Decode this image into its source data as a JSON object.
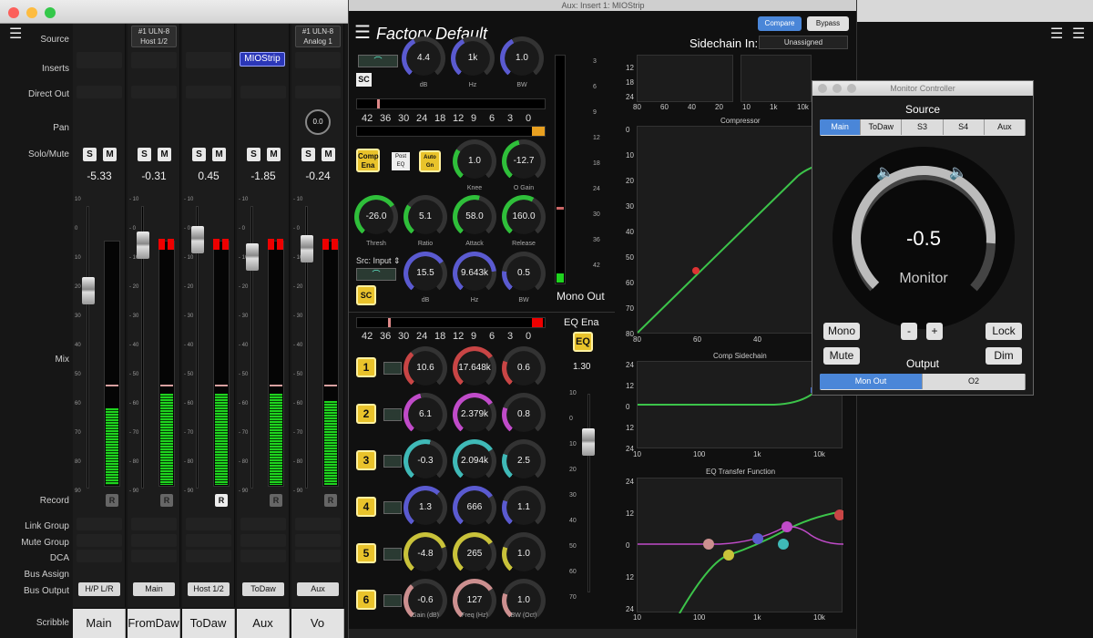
{
  "mixer": {
    "row_labels": {
      "source": "Source",
      "inserts": "Inserts",
      "direct_out": "Direct Out",
      "pan": "Pan",
      "solo_mute": "Solo/Mute",
      "mix": "Mix",
      "record": "Record",
      "link_group": "Link Group",
      "mute_group": "Mute Group",
      "dca": "DCA",
      "bus_assign": "Bus Assign",
      "bus_output": "Bus Output",
      "scribble": "Scribble"
    },
    "solo_label": "S",
    "mute_label": "M",
    "record_label": "R",
    "fader_scale": [
      "10",
      "0",
      "10",
      "20",
      "30",
      "40",
      "50",
      "60",
      "70",
      "80",
      "90"
    ],
    "fader_scale_alt": [
      "- 10",
      "- 0",
      "- 10",
      "- 20",
      "- 30",
      "- 40",
      "- 50",
      "- 60",
      "- 70",
      "- 80",
      "- 90"
    ],
    "channels": [
      {
        "source_line1": "",
        "source_line2": "",
        "insert": "",
        "pan": "",
        "gain": "-5.33",
        "bus_output": "H/P L/R",
        "scribble": "Main",
        "meter_level": 0.31,
        "fader_level": 0.7,
        "record_active": false
      },
      {
        "source_line1": "#1 ULN-8",
        "source_line2": "Host 1/2",
        "insert": "",
        "pan": "",
        "gain": "-0.31",
        "bus_output": "Main",
        "scribble": "FromDaw",
        "meter_level": 0.37,
        "fader_level": 0.86,
        "record_active": false
      },
      {
        "source_line1": "",
        "source_line2": "",
        "insert": "",
        "pan": "",
        "gain": "0.45",
        "bus_output": "Host 1/2",
        "scribble": "ToDaw",
        "meter_level": 0.37,
        "fader_level": 0.88,
        "record_active": true
      },
      {
        "source_line1": "",
        "source_line2": "",
        "insert": "MIOStrip",
        "pan": "",
        "gain": "-1.85",
        "bus_output": "ToDaw",
        "scribble": "Aux",
        "meter_level": 0.37,
        "fader_level": 0.82,
        "record_active": false
      },
      {
        "source_line1": "#1 ULN-8",
        "source_line2": "Analog 1",
        "insert": "",
        "pan": "0.0",
        "gain": "-0.24",
        "bus_output": "Aux",
        "scribble": "Vo",
        "meter_level": 0.34,
        "fader_level": 0.85,
        "record_active": false
      }
    ]
  },
  "plugin": {
    "window_title": "Aux: Insert 1: MIOStrip",
    "preset": "Factory Default",
    "compare_label": "Compare",
    "bypass_label": "Bypass",
    "sidechain_label": "Sidechain In:",
    "sidechain_value": "Unassigned",
    "sc_label": "SC",
    "top_knobs": [
      {
        "value": "4.4",
        "label": "dB"
      },
      {
        "value": "1k",
        "label": "Hz"
      },
      {
        "value": "1.0",
        "label": "BW"
      }
    ],
    "meter_scale": [
      "42",
      "36",
      "30",
      "24",
      "18",
      "12",
      "9",
      "6",
      "3",
      "0"
    ],
    "comp_ena": "Comp Ena",
    "post_eq": "Post EQ",
    "auto_gn": "Auto Gn",
    "comp_knobs": [
      {
        "value": "1.0",
        "label": "Knee"
      },
      {
        "value": "-12.7",
        "label": "O Gain"
      },
      {
        "value": "-26.0",
        "label": "Thresh"
      },
      {
        "value": "5.1",
        "label": "Ratio"
      },
      {
        "value": "58.0",
        "label": "Attack"
      },
      {
        "value": "160.0",
        "label": "Release"
      }
    ],
    "src_label": "Src: Input",
    "sc_knobs": [
      {
        "value": "15.5",
        "label": "dB"
      },
      {
        "value": "9.643k",
        "label": "Hz"
      },
      {
        "value": "0.5",
        "label": "BW"
      }
    ],
    "mono_out": "Mono Out",
    "mono_scale": [
      "3",
      "6",
      "9",
      "12",
      "18",
      "24",
      "30",
      "36",
      "42"
    ],
    "eq_ena": "EQ Ena",
    "eq_btn": "EQ",
    "eq_gain_value": "1.30",
    "eq_fader_scale": [
      "10",
      "0",
      "10",
      "20",
      "30",
      "40",
      "50",
      "60",
      "70"
    ],
    "bands": [
      {
        "num": "1",
        "gain": "10.6",
        "freq": "17.648k",
        "bw": "0.6",
        "color": "#c84545"
      },
      {
        "num": "2",
        "gain": "6.1",
        "freq": "2.379k",
        "bw": "0.8",
        "color": "#c04bc9"
      },
      {
        "num": "3",
        "gain": "-0.3",
        "freq": "2.094k",
        "bw": "2.5",
        "color": "#3fb9b7"
      },
      {
        "num": "4",
        "gain": "1.3",
        "freq": "666",
        "bw": "1.1",
        "color": "#5a5ad0"
      },
      {
        "num": "5",
        "gain": "-4.8",
        "freq": "265",
        "bw": "1.0",
        "color": "#c9c23a"
      },
      {
        "num": "6",
        "gain": "-0.6",
        "freq": "127",
        "bw": "1.0",
        "color": "#cc8f8f"
      }
    ],
    "band_labels": {
      "gain": "Gain (dB)",
      "freq": "Freq (Hz)",
      "bw": "BW (Oct)"
    },
    "graph_titles": {
      "compressor": "Compressor",
      "sidechain": "Comp Sidechain",
      "eq": "EQ Transfer Function"
    },
    "comp_axis_y": [
      "0",
      "10",
      "20",
      "30",
      "40",
      "50",
      "60",
      "70",
      "80"
    ],
    "comp_axis_x": [
      "80",
      "60",
      "40",
      "20"
    ],
    "top_axis_x": [
      "80",
      "60",
      "40",
      "20",
      "10",
      "1k",
      "10k"
    ],
    "top_axis_y": [
      "12",
      "18",
      "24"
    ],
    "sc_axis_y": [
      "24",
      "12",
      "0",
      "12",
      "24"
    ],
    "freq_axis": [
      "10",
      "100",
      "1k",
      "10k"
    ],
    "eq_axis_y": [
      "24",
      "12",
      "0",
      "12",
      "24"
    ]
  },
  "monitor": {
    "title": "Monitor Controller",
    "source_label": "Source",
    "source_tabs": [
      "Main",
      "ToDaw",
      "S3",
      "S4",
      "Aux"
    ],
    "selected_source": "Main",
    "level_value": "-0.5",
    "level_label": "Monitor",
    "level_fraction": 0.85,
    "mono": "Mono",
    "minus": "-",
    "plus": "+",
    "lock": "Lock",
    "mute": "Mute",
    "dim": "Dim",
    "output_label": "Output",
    "output_tabs": [
      "Mon Out",
      "O2"
    ],
    "selected_output": "Mon Out"
  },
  "colors": {
    "green": "#1fd31f",
    "yellow": "#e9c32b",
    "accent_blue": "#4a86d8"
  }
}
